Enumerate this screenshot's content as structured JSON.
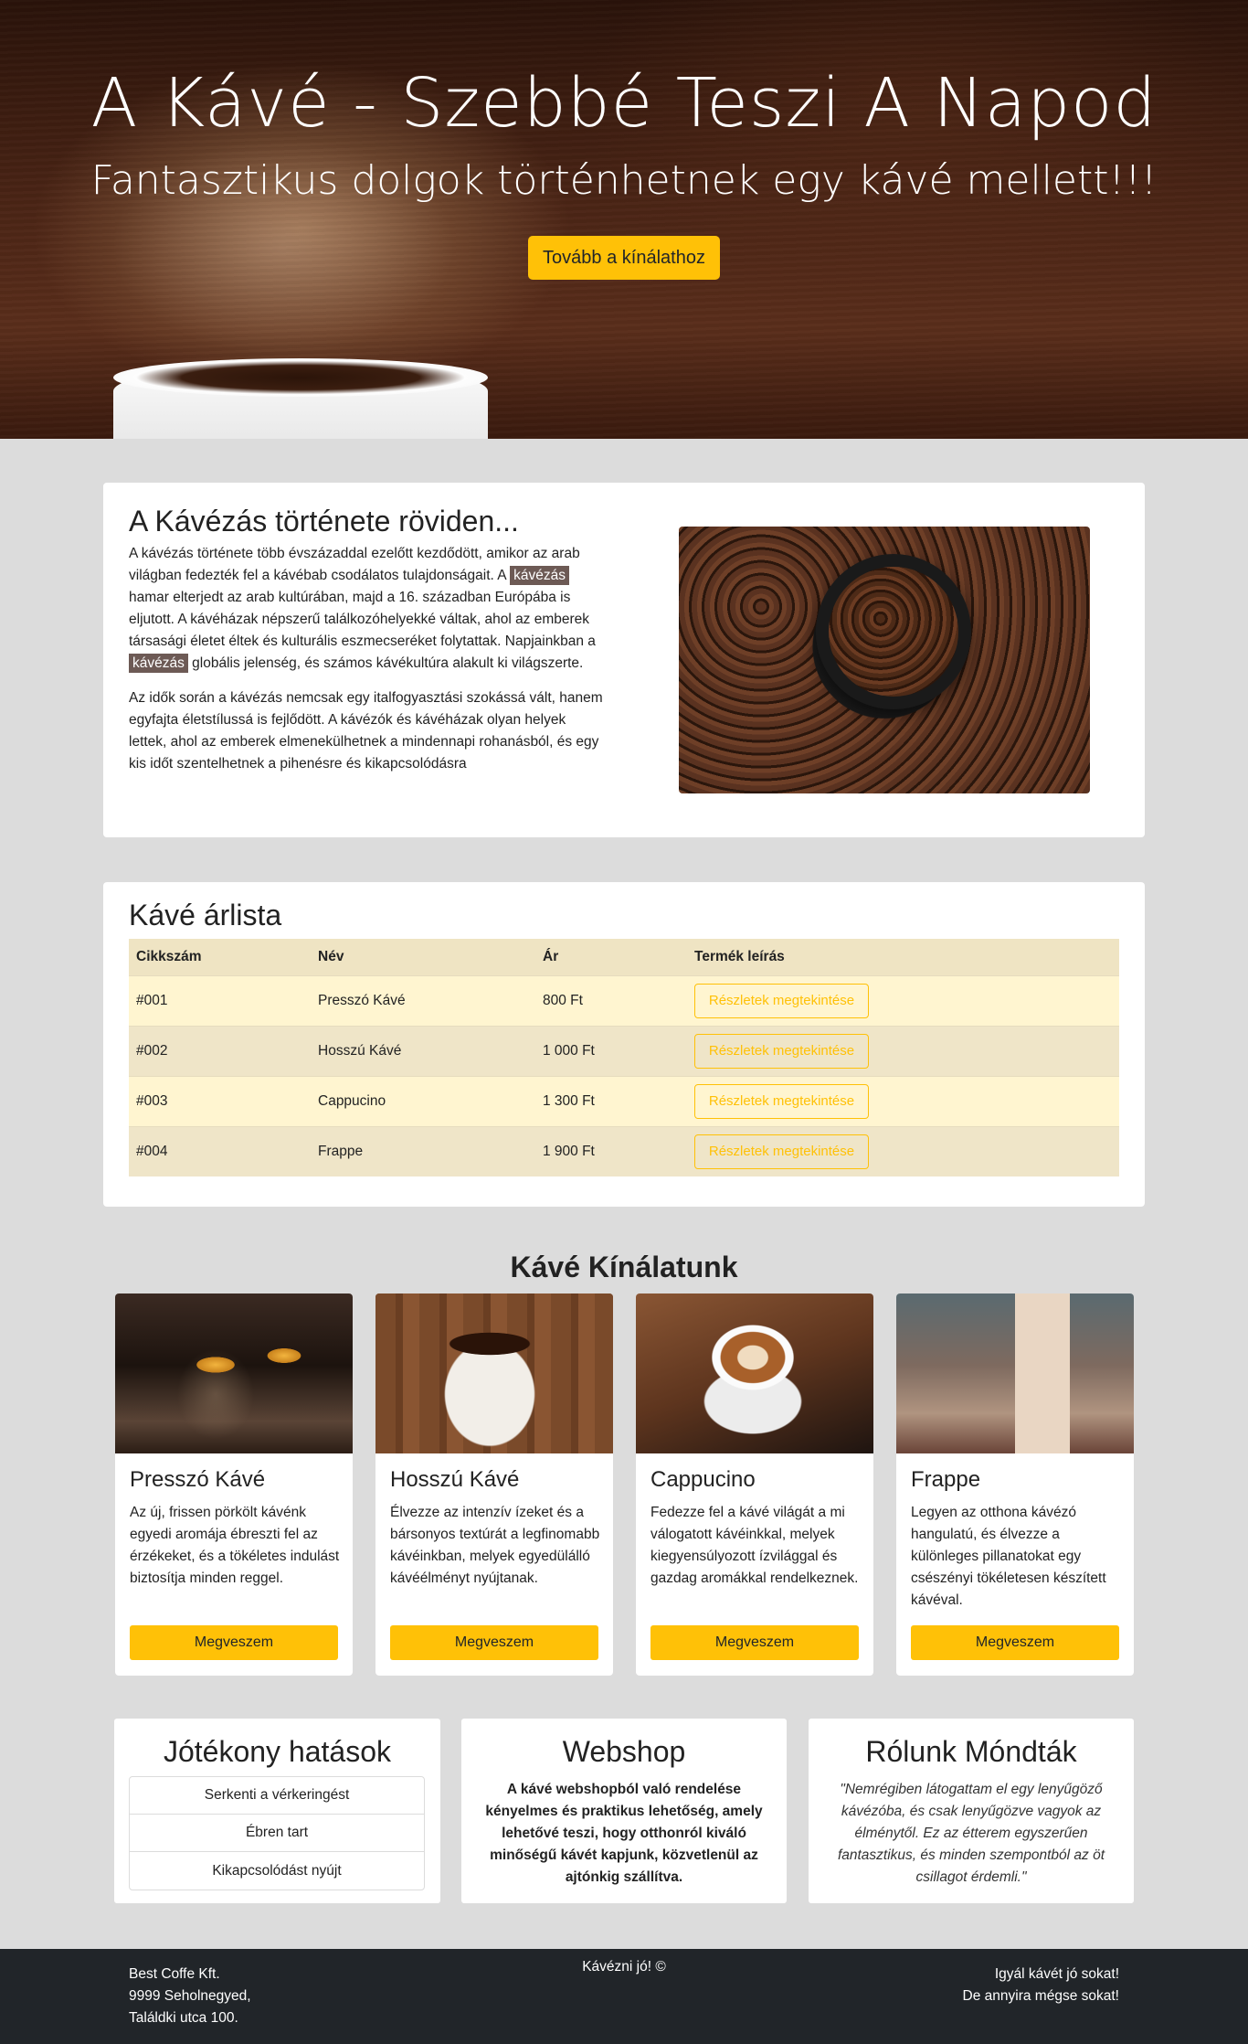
{
  "hero": {
    "title": "A Kávé - Szebbé Teszi A Napod",
    "subtitle": "Fantasztikus dolgok történhetnek egy kávé mellett!!!",
    "cta_label": "Tovább a kínálathoz"
  },
  "history": {
    "title": "A Kávézás története röviden...",
    "p1_part1": "A kávézás története több évszázaddal ezelőtt kezdődött, amikor az arab világban fedezték fel a kávébab csodálatos tulajdonságait. A ",
    "p1_mark1": "kávézás",
    "p1_part2": " hamar elterjedt az arab kultúrában, majd a 16. században Európába is eljutott. A kávéházak népszerű találkozóhelyekké váltak, ahol az emberek társasági életet éltek és kulturális eszmecseréket folytattak. Napjainkban a ",
    "p1_mark2": "kávézás",
    "p1_part3": " globális jelenség, és számos kávékultúra alakult ki világszerte.",
    "p2": "Az idők során a kávézás nemcsak egy italfogyasztási szokássá vált, hanem egyfajta életstílussá is fejlődött. A kávézók és kávéházak olyan helyek lettek, ahol az emberek elmenekülhetnek a mindennapi rohanásból, és egy kis időt szentelhetnek a pihenésre és kikapcsolódásra"
  },
  "pricelist": {
    "title": "Kávé árlista",
    "columns": [
      "Cikkszám",
      "Név",
      "Ár",
      "Termék leírás"
    ],
    "rows": [
      {
        "id": "#001",
        "name": "Presszó Kávé",
        "price": "800 Ft",
        "button": "Részletek megtekintése"
      },
      {
        "id": "#002",
        "name": "Hosszú Kávé",
        "price": "1 000 Ft",
        "button": "Részletek megtekintése"
      },
      {
        "id": "#003",
        "name": "Cappucino",
        "price": "1 300 Ft",
        "button": "Részletek megtekintése"
      },
      {
        "id": "#004",
        "name": "Frappe",
        "price": "1 900 Ft",
        "button": "Részletek megtekintése"
      }
    ]
  },
  "offer": {
    "title": "Kávé Kínálatunk",
    "products": [
      {
        "name": "Presszó Kávé",
        "desc": "Az új, frissen pörkölt kávénk egyedi aromája ébreszti fel az érzékeket, és a tökéletes indulást biztosítja minden reggel.",
        "button": "Megveszem"
      },
      {
        "name": "Hosszú Kávé",
        "desc": "Élvezze az intenzív ízeket és a bársonyos textúrát a legfinomabb kávéinkban, melyek egyedülálló kávéélményt nyújtanak.",
        "button": "Megveszem"
      },
      {
        "name": "Cappucino",
        "desc": "Fedezze fel a kávé világát a mi válogatott kávéinkkal, melyek kiegyensúlyozott ízvilággal és gazdag aromákkal rendelkeznek.",
        "button": "Megveszem"
      },
      {
        "name": "Frappe",
        "desc": "Legyen az otthona kávézó hangulatú, és élvezze a különleges pillanatokat egy csészényi tökéletesen készített kávéval.",
        "button": "Megveszem"
      }
    ]
  },
  "benefits": {
    "title": "Jótékony hatások",
    "items": [
      "Serkenti a vérkeringést",
      "Ébren tart",
      "Kikapcsolódást nyújt"
    ]
  },
  "webshop": {
    "title": "Webshop",
    "text": "A kávé webshopból való rendelése kényelmes és praktikus lehetőség, amely lehetővé teszi, hogy otthonról kiváló minőségű kávét kapjunk, közvetlenül az ajtónkig szállítva."
  },
  "reviews": {
    "title": "Rólunk Móndták",
    "text": "\"Nemrégiben látogattam el egy lenyűgöző kávézóba, és csak lenyűgözve vagyok az élménytől. Ez az étterem egyszerűen fantasztikus, és minden szempontból az öt csillagot érdemli.\""
  },
  "footer": {
    "company": "Best Coffe Kft.",
    "address1": "9999 Seholnegyed,",
    "address2": "Találdki utca 100.",
    "center": "Kávézni jó! ©",
    "right1": "Igyál kávét jó sokat!",
    "right2": "De annyira mégse sokat!"
  },
  "colors": {
    "accent": "#ffc107",
    "footer_bg": "#212529",
    "page_bg": "#dcdcdc",
    "highlight": "#6d5a55"
  }
}
